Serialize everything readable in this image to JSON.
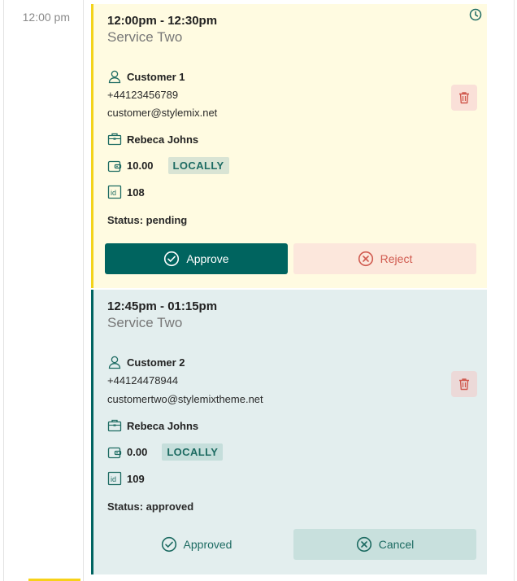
{
  "timeline": {
    "time_label": "12:00 pm"
  },
  "bookings": [
    {
      "time_range": "12:00pm - 12:30pm",
      "service": "Service Two",
      "customer_name": "Customer 1",
      "phone": "+44123456789",
      "email": "customer@stylemix.net",
      "employee": "Rebeca Johns",
      "price": "10.00",
      "payment": "LOCALLY",
      "id": "108",
      "status": "Status: pending",
      "primary_action": "Approve",
      "secondary_action": "Reject"
    },
    {
      "time_range": "12:45pm - 01:15pm",
      "service": "Service Two",
      "customer_name": "Customer 2",
      "phone": "+44124478944",
      "email": "customertwo@stylemixtheme.net",
      "employee": "Rebeca Johns",
      "price": "0.00",
      "payment": "LOCALLY",
      "id": "109",
      "status": "Status: approved",
      "primary_action": "Approved",
      "secondary_action": "Cancel"
    }
  ],
  "colors": {
    "pending_bg": "#fffbe1",
    "pending_accent": "#f3d31b",
    "approved_bg": "#e3eeee",
    "approved_accent": "#006461",
    "primary_teal": "#00645f",
    "reject_red": "#d05a4f"
  },
  "icons": [
    "clock-icon",
    "user-icon",
    "briefcase-icon",
    "wallet-icon",
    "id-icon",
    "trash-icon",
    "check-circle-icon",
    "x-circle-icon"
  ]
}
